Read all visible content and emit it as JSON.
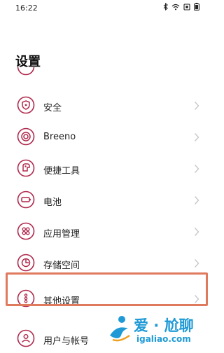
{
  "status_bar": {
    "time": "16:22",
    "icons": [
      "bluetooth-icon",
      "wifi-icon",
      "sim-icon",
      "battery-icon"
    ]
  },
  "page": {
    "title": "设置"
  },
  "colors": {
    "accent": "#b0284c",
    "highlight": "#e07a5f",
    "watermark": "#1f9ad6"
  },
  "items": [
    {
      "label": "安全",
      "icon": "shield-icon"
    },
    {
      "label": "Breeno",
      "icon": "breeno-icon"
    },
    {
      "label": "便捷工具",
      "icon": "tools-icon"
    },
    {
      "label": "电池",
      "icon": "battery-setting-icon"
    },
    {
      "label": "应用管理",
      "icon": "apps-icon"
    },
    {
      "label": "存储空间",
      "icon": "storage-icon"
    },
    {
      "label": "其他设置",
      "icon": "more-settings-icon"
    },
    {
      "label": "用户与帐号",
      "icon": "user-icon"
    }
  ],
  "watermark": {
    "line1": "爱 · 尬聊",
    "line2": "igaliao.com"
  }
}
